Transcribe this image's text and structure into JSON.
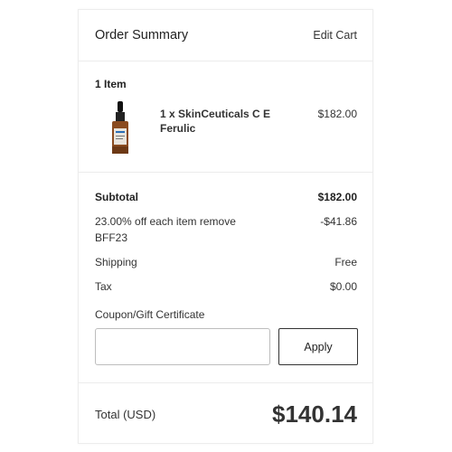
{
  "summary": {
    "title": "Order Summary",
    "edit_cart": "Edit Cart"
  },
  "items": {
    "count": "1 Item",
    "product": {
      "name": "1 x SkinCeuticals C E Ferulic",
      "price": "$182.00",
      "image_icon": "serum-bottle-icon"
    }
  },
  "totals": {
    "subtotal_label": "Subtotal",
    "subtotal_value": "$182.00",
    "discount_label": "23.00% off each item remove BFF23",
    "discount_value": "-$41.86",
    "shipping_label": "Shipping",
    "shipping_value": "Free",
    "tax_label": "Tax",
    "tax_value": "$0.00"
  },
  "coupon": {
    "label": "Coupon/Gift Certificate",
    "input_value": "",
    "apply_label": "Apply"
  },
  "grand_total": {
    "label": "Total (USD)",
    "value": "$140.14"
  }
}
